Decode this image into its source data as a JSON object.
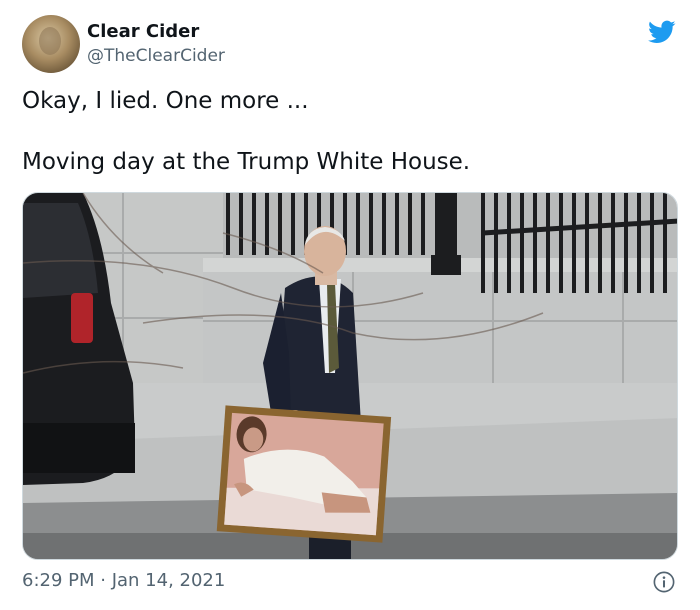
{
  "author": {
    "display_name": "Clear Cider",
    "handle": "@TheClearCider"
  },
  "tweet": {
    "line1": "Okay, I lied.  One more ...",
    "line2": "Moving day at the Trump White House."
  },
  "meta": {
    "timestamp": "6:29 PM · Jan 14, 2021"
  },
  "icons": {
    "brand": "twitter-bird-icon",
    "info": "info-icon"
  },
  "colors": {
    "twitter_blue": "#1d9bf0",
    "secondary_text": "#536471"
  }
}
